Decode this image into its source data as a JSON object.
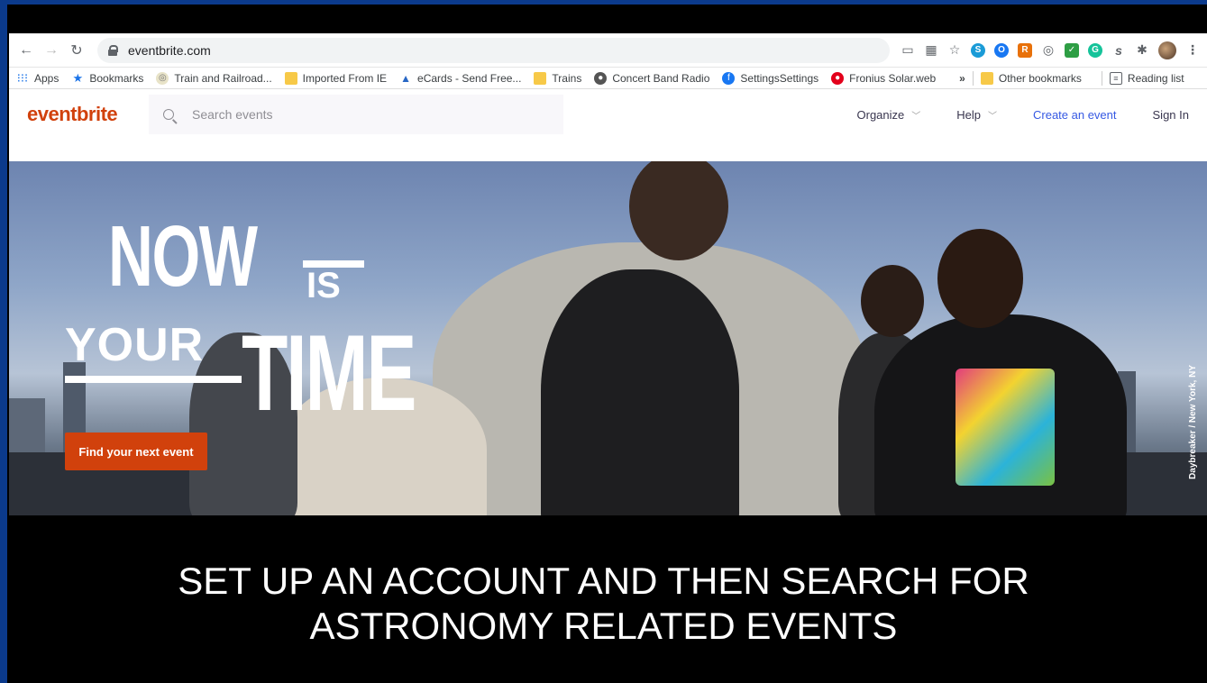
{
  "browser": {
    "url": "eventbrite.com",
    "bookmarks": [
      {
        "label": "Apps",
        "icon": "apps-grid-icon"
      },
      {
        "label": "Bookmarks",
        "icon": "star-icon"
      },
      {
        "label": "Train and Railroad...",
        "icon": "site-icon"
      },
      {
        "label": "Imported From IE",
        "icon": "folder-icon"
      },
      {
        "label": "eCards - Send Free...",
        "icon": "site-icon"
      },
      {
        "label": "Trains",
        "icon": "folder-icon"
      },
      {
        "label": "Concert Band Radio",
        "icon": "site-icon"
      },
      {
        "label": "SettingsSettings",
        "icon": "facebook-icon"
      },
      {
        "label": "Fronius Solar.web",
        "icon": "site-icon"
      }
    ],
    "overflow_label": "»",
    "other_bookmarks": "Other bookmarks",
    "reading_list": "Reading list"
  },
  "eventbrite": {
    "logo": "eventbrite",
    "search_placeholder": "Search events",
    "nav": {
      "organize": "Organize",
      "help": "Help",
      "create": "Create an event",
      "signin": "Sign In"
    },
    "hero": {
      "line1": "NOW",
      "line1_small": "IS",
      "line2": "YOUR",
      "line2_big": "TIME",
      "cta": "Find your next event",
      "credit": "Daybreaker / New York, NY"
    }
  },
  "slide": {
    "caption_line1": "SET UP AN ACCOUNT AND THEN SEARCH FOR",
    "caption_line2": "ASTRONOMY RELATED EVENTS"
  },
  "colors": {
    "brand": "#d1410c",
    "link": "#3659e3",
    "slide_border": "#0b3a8c"
  }
}
